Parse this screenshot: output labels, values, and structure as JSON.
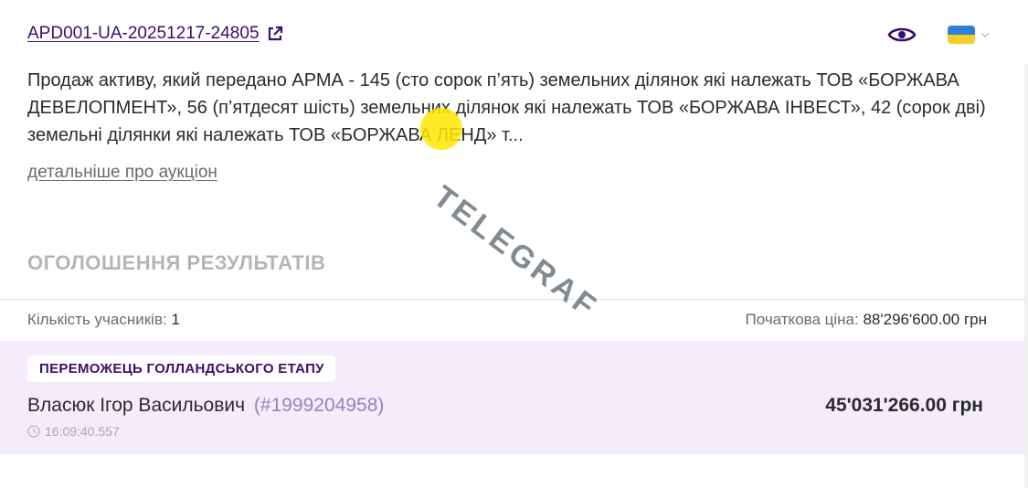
{
  "header": {
    "auction_id": "APD001-UA-20251217-24805",
    "external_link_icon": "external-link-icon",
    "eye_icon": "eye-icon",
    "language_flag": "ukraine-flag-icon",
    "flag_colors": {
      "top": "#2f7fd6",
      "bottom": "#f7cf2a"
    }
  },
  "description": "Продаж активу, який передано АРМА - 145 (сто сорок п’ять) земельних ділянок які належать ТОВ «БОРЖАВА ДЕВЕЛОПМЕНТ», 56 (п’ятдесят шість) земельних ділянок які належать ТОВ «БОРЖАВА ІНВЕСТ», 42 (сорок дві) земельні ділянки які належать ТОВ «БОРЖАВА ЛЕНД» т...",
  "details_link": "детальніше про аукціон",
  "results": {
    "section_title": "ОГОЛОШЕННЯ РЕЗУЛЬТАТІВ",
    "participants_label": "Кількість учасників:",
    "participants_value": "1",
    "start_price_label": "Початкова ціна:",
    "start_price_value": "88'296'600.00 грн",
    "winner": {
      "badge": "ПЕРЕМОЖЕЦЬ ГОЛЛАНДСЬКОГО ЕТАПУ",
      "name": "Власюк Ігор Васильович",
      "id": "(#1999204958)",
      "amount": "45'031'266.00 грн",
      "time": "16:09:40.557"
    }
  },
  "watermark": {
    "text": "TELEGRAF"
  },
  "colors": {
    "accent": "#3b0f6b",
    "winner_bg": "#f3ecfb",
    "muted": "#b5b5b5"
  }
}
